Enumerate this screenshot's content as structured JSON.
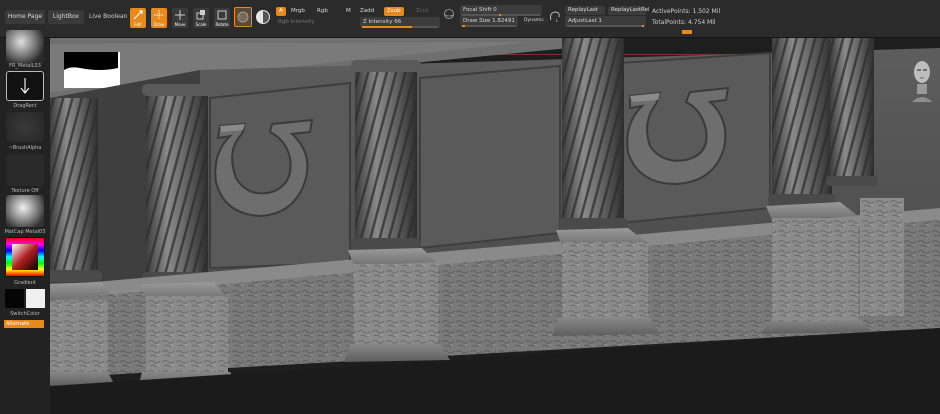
{
  "topbar": {
    "home_page": "Home Page",
    "lightbox": "LightBox",
    "live_boolean": "Live Boolean",
    "tools": {
      "edit": "Edit",
      "draw": "Draw",
      "move": "Move",
      "scale": "Scale",
      "rotate": "Rotate"
    },
    "modes": {
      "a": "A",
      "mrgb": "Mrgb",
      "rgb": "Rgb",
      "m": "M",
      "zadd": "Zadd",
      "zsub": "Zsub",
      "zcut": "Zcut"
    },
    "rgb_intensity": "Rgb Intensity",
    "z_intensity": "Z Intensity 66",
    "z_intensity_value": 0.66,
    "focal_shift": "Focal Shift 0",
    "focal_shift_value": 0.5,
    "draw_size_label": "Draw Size",
    "draw_size_value": "1.82491",
    "draw_size_fill": 0.05,
    "dynamic": "Dynamic",
    "replay_last": "ReplayLast",
    "replay_last_rel": "ReplayLastRel",
    "adjust_last": "AdjustLast 1",
    "active_points": "ActivePoints: 1.502 Mil",
    "total_points": "TotalPoints: 4.754 Mil"
  },
  "leftbar": {
    "material": "FR_MetalL03",
    "stroke": "DragRect",
    "alpha": "~BrushAlpha",
    "texture": "Texture Off",
    "matcap": "MatCap Metal03",
    "gradient": "Gradient",
    "switch_color": "SwitchColor",
    "alternate": "Alternate"
  },
  "colors": {
    "accent": "#e8891c",
    "bg": "#1d1d1d",
    "panel": "#2b2b2b"
  }
}
